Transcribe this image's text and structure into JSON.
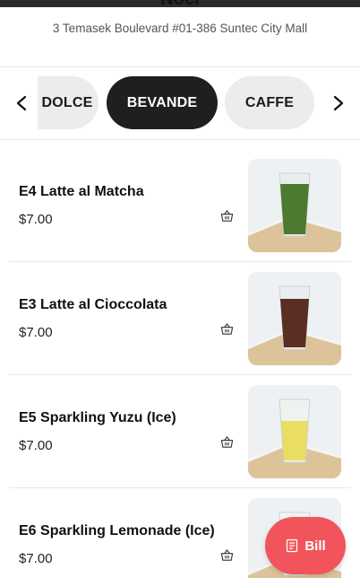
{
  "store": {
    "name": "Noci",
    "address": "3 Temasek Boulevard #01-386 Suntec City Mall"
  },
  "categories": {
    "tabs": [
      {
        "label": "DOLCE"
      },
      {
        "label": "BEVANDE"
      },
      {
        "label": "CAFFE"
      }
    ],
    "active": "BEVANDE"
  },
  "menu": {
    "items": [
      {
        "name": "E4 Latte al Matcha",
        "price": "$7.00",
        "drink_color": "#4e7a2f"
      },
      {
        "name": "E3 Latte al Cioccolata",
        "price": "$7.00",
        "drink_color": "#5a2e22"
      },
      {
        "name": "E5 Sparkling Yuzu (Ice)",
        "price": "$7.00",
        "drink_color": "#e8d84a"
      },
      {
        "name": "E6 Sparkling Lemonade (Ice)",
        "price": "$7.00",
        "drink_color": "#eef0d8"
      }
    ]
  },
  "bill_button": {
    "label": "Bill",
    "color": "#f2545b"
  },
  "icons": {
    "left": "chevron-left-icon",
    "right": "chevron-right-icon",
    "basket": "basket-icon",
    "bill": "receipt-icon"
  }
}
